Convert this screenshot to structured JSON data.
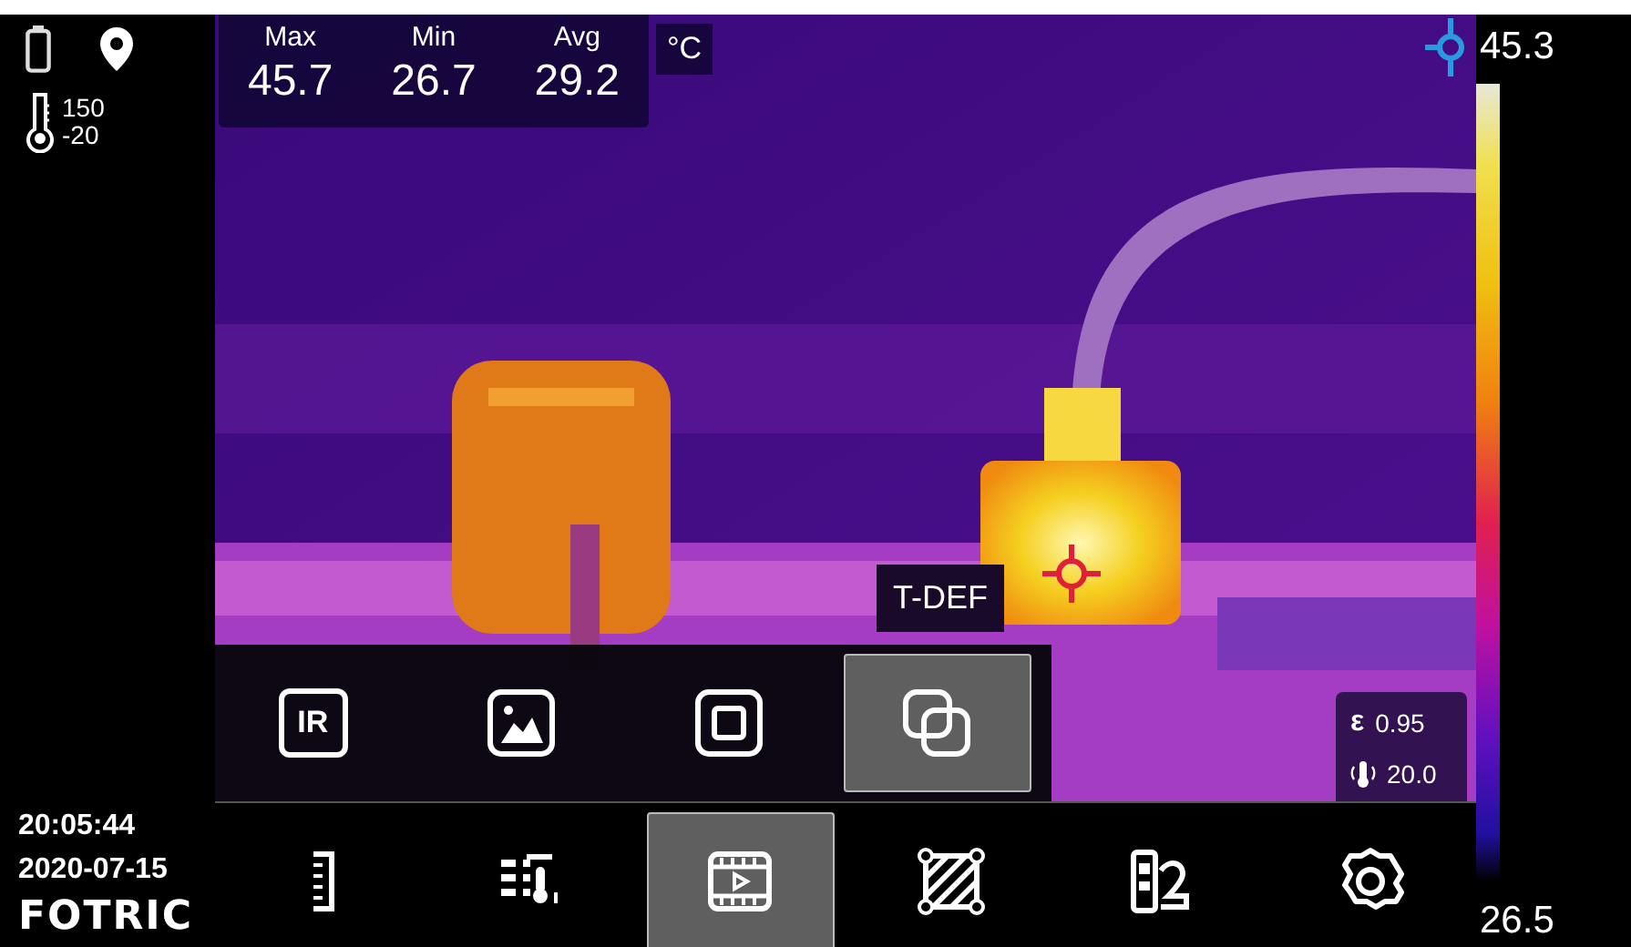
{
  "status": {
    "range_high": "150",
    "range_low": "-20"
  },
  "clock": {
    "time": "20:05:44",
    "date": "2020-07-15"
  },
  "brand": "FOTRIC",
  "stats": {
    "unit": "°C",
    "items": [
      {
        "label": "Max",
        "value": "45.7"
      },
      {
        "label": "Min",
        "value": "26.7"
      },
      {
        "label": "Avg",
        "value": "29.2"
      }
    ]
  },
  "scale": {
    "max": "45.3",
    "min": "26.5"
  },
  "mode_menu": {
    "tooltip": "T-DEF",
    "items": [
      {
        "kind": "ir",
        "label": "IR",
        "selected": false
      },
      {
        "kind": "visual",
        "selected": false
      },
      {
        "kind": "frame",
        "selected": false
      },
      {
        "kind": "fusion",
        "selected": true
      }
    ]
  },
  "params": {
    "emissivity_symbol": "ε",
    "emissivity": "0.95",
    "reflected_temp": "20.0"
  },
  "toolbar": [
    {
      "kind": "ruler",
      "selected": false
    },
    {
      "kind": "probe_list",
      "selected": false
    },
    {
      "kind": "video",
      "selected": true
    },
    {
      "kind": "area",
      "selected": false
    },
    {
      "kind": "palette",
      "selected": false
    },
    {
      "kind": "settings",
      "selected": false
    }
  ]
}
